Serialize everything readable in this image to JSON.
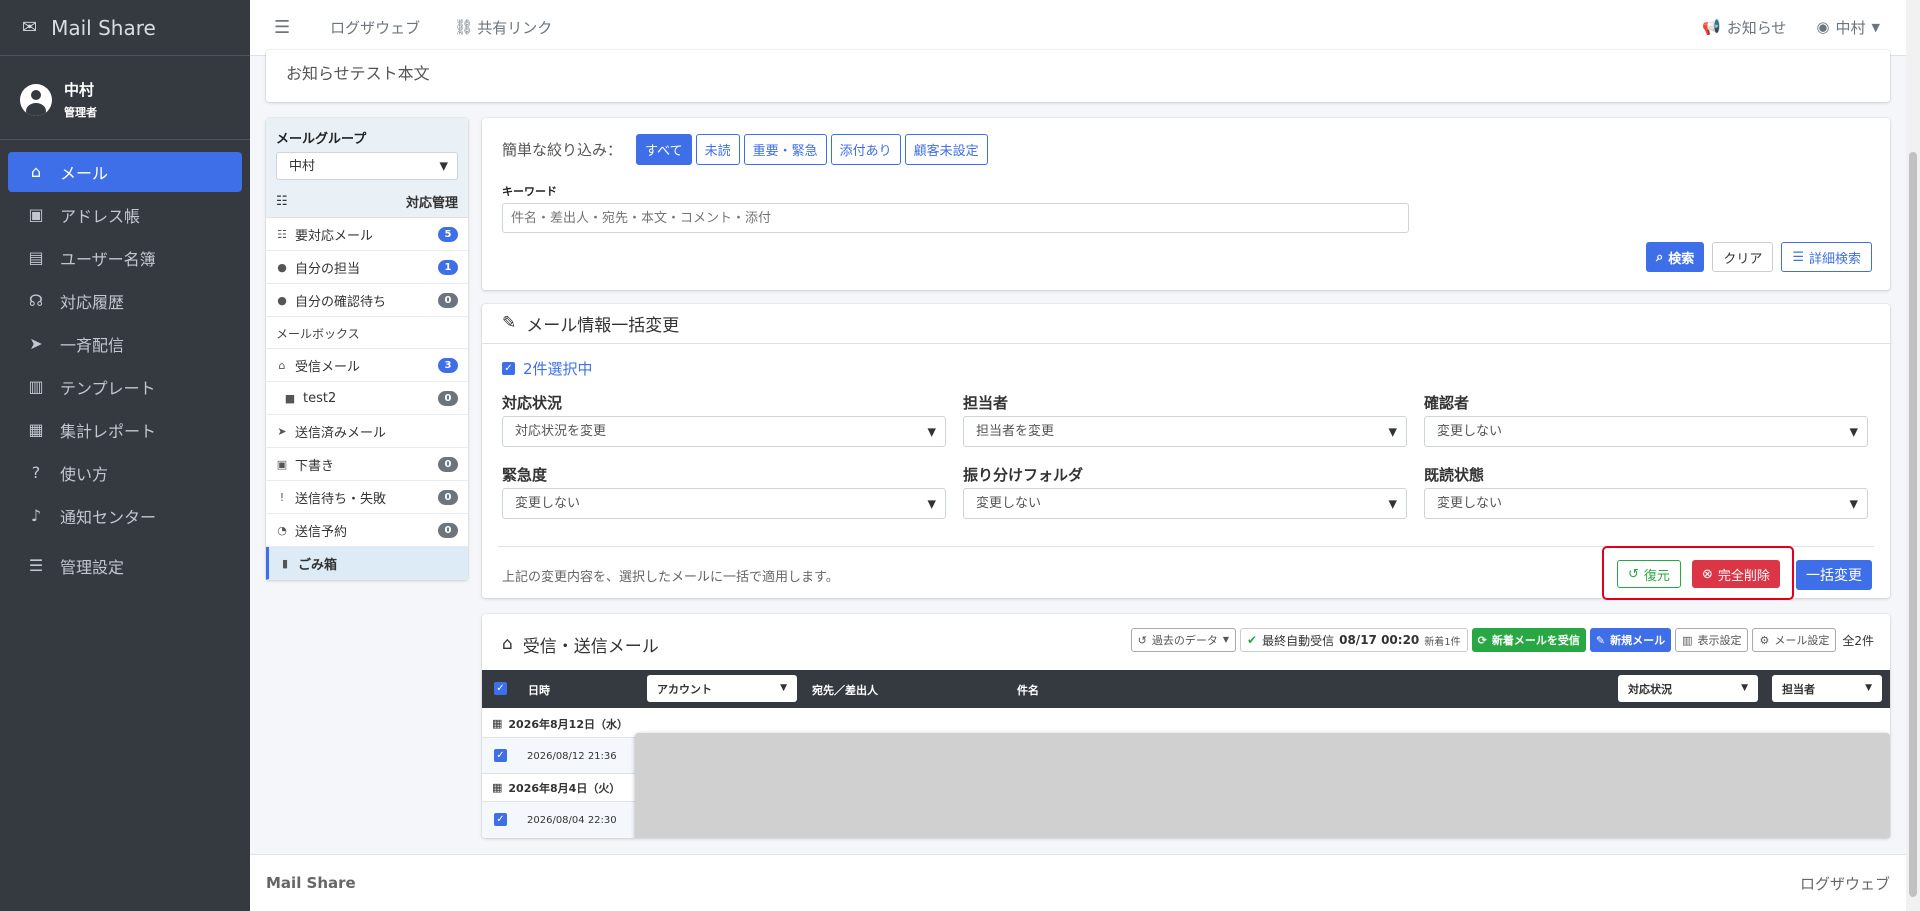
{
  "app": {
    "title": "Mail Share"
  },
  "user": {
    "name": "中村",
    "role": "管理者"
  },
  "nav": [
    {
      "label": "メール",
      "icon": "inbox-icon",
      "glyph": "⌂",
      "active": true
    },
    {
      "label": "アドレス帳",
      "icon": "address-book-icon",
      "glyph": "▣"
    },
    {
      "label": "ユーザー名簿",
      "icon": "id-card-icon",
      "glyph": "▤"
    },
    {
      "label": "対応履歴",
      "icon": "headset-icon",
      "glyph": "☊"
    },
    {
      "label": "一斉配信",
      "icon": "paper-plane-icon",
      "glyph": "➤"
    },
    {
      "label": "テンプレート",
      "icon": "file-icon",
      "glyph": "▥"
    },
    {
      "label": "集計レポート",
      "icon": "chart-icon",
      "glyph": "▦"
    },
    {
      "label": "使い方",
      "icon": "question-icon",
      "glyph": "?"
    },
    {
      "label": "通知センター",
      "icon": "bell-icon",
      "glyph": "♪"
    },
    {
      "label": "管理設定",
      "icon": "sliders-icon",
      "glyph": "☰"
    }
  ],
  "topbar": {
    "link1": "ログザウェブ",
    "link2": "共有リンク",
    "news": "お知らせ",
    "user": "中村"
  },
  "notice": {
    "body": "お知らせテスト本文"
  },
  "leftpanel": {
    "group_label": "メールグループ",
    "group_value": "中村",
    "manage_label": "対応管理",
    "items1": [
      {
        "label": "要対応メール",
        "count": "5",
        "color": "blue",
        "icon": "list-icon",
        "glyph": "☷"
      },
      {
        "label": "自分の担当",
        "count": "1",
        "color": "blue",
        "icon": "user-icon",
        "glyph": "●"
      },
      {
        "label": "自分の確認待ち",
        "count": "0",
        "color": "gray",
        "icon": "user-check-icon",
        "glyph": "●"
      }
    ],
    "mailbox_label": "メールボックス",
    "items2": [
      {
        "label": "受信メール",
        "count": "3",
        "color": "blue",
        "icon": "inbox-icon",
        "glyph": "⌂"
      },
      {
        "label": "test2",
        "count": "0",
        "color": "gray",
        "icon": "folder-icon",
        "glyph": "■",
        "indent": true
      },
      {
        "label": "送信済みメール",
        "count": "",
        "icon": "paper-plane-icon",
        "glyph": "➤"
      },
      {
        "label": "下書き",
        "count": "0",
        "color": "gray",
        "icon": "save-icon",
        "glyph": "▣"
      },
      {
        "label": "送信待ち・失敗",
        "count": "0",
        "color": "gray",
        "icon": "exclamation-icon",
        "glyph": "!"
      },
      {
        "label": "送信予約",
        "count": "0",
        "color": "gray",
        "icon": "clock-icon",
        "glyph": "◔"
      },
      {
        "label": "ごみ箱",
        "count": "",
        "icon": "trash-icon",
        "glyph": "▮",
        "active": true
      }
    ]
  },
  "filter": {
    "label": "簡単な絞り込み：",
    "buttons": [
      "すべて",
      "未読",
      "重要・緊急",
      "添付あり",
      "顧客未設定"
    ],
    "keyword_label": "キーワード",
    "keyword_placeholder": "件名・差出人・宛先・本文・コメント・添付",
    "search": "検索",
    "clear": "クリア",
    "advanced": "詳細検索"
  },
  "bulk": {
    "title": "メール情報一括変更",
    "selected": "2件選択中",
    "fields": [
      {
        "label": "対応状況",
        "value": "対応状況を変更"
      },
      {
        "label": "担当者",
        "value": "担当者を変更"
      },
      {
        "label": "確認者",
        "value": "変更しない"
      },
      {
        "label": "緊急度",
        "value": "変更しない"
      },
      {
        "label": "振り分けフォルダ",
        "value": "変更しない"
      },
      {
        "label": "既読状態",
        "value": "変更しない"
      }
    ],
    "note": "上記の変更内容を、選択したメールに一括で適用します。",
    "restore": "復元",
    "delete": "完全削除",
    "apply": "一括変更"
  },
  "mails": {
    "title": "受信・送信メール",
    "past": "過去のデータ",
    "last_recv": "最終自動受信",
    "last_time": "08/17 00:20",
    "new_count": "新着1件",
    "receive": "新着メールを受信",
    "compose": "新規メール",
    "display": "表示設定",
    "mail_settings": "メール設定",
    "total": "全2件",
    "columns": {
      "date": "日時",
      "account": "アカウント",
      "to_from": "宛先／差出人",
      "subject": "件名",
      "status": "対応状況",
      "assignee": "担当者"
    },
    "groups": [
      {
        "date": "2026年8月12日（水）",
        "time": "2026/08/12 21:36"
      },
      {
        "date": "2026年8月4日（火）",
        "time": "2026/08/04 22:30"
      }
    ]
  },
  "footer": {
    "left": "Mail Share",
    "right": "ログザウェブ"
  },
  "colors": {
    "accent": "#3f6fe8",
    "sidebar": "#343a40",
    "success": "#28a745",
    "danger": "#dc3545",
    "highlight": "#e0001b"
  }
}
